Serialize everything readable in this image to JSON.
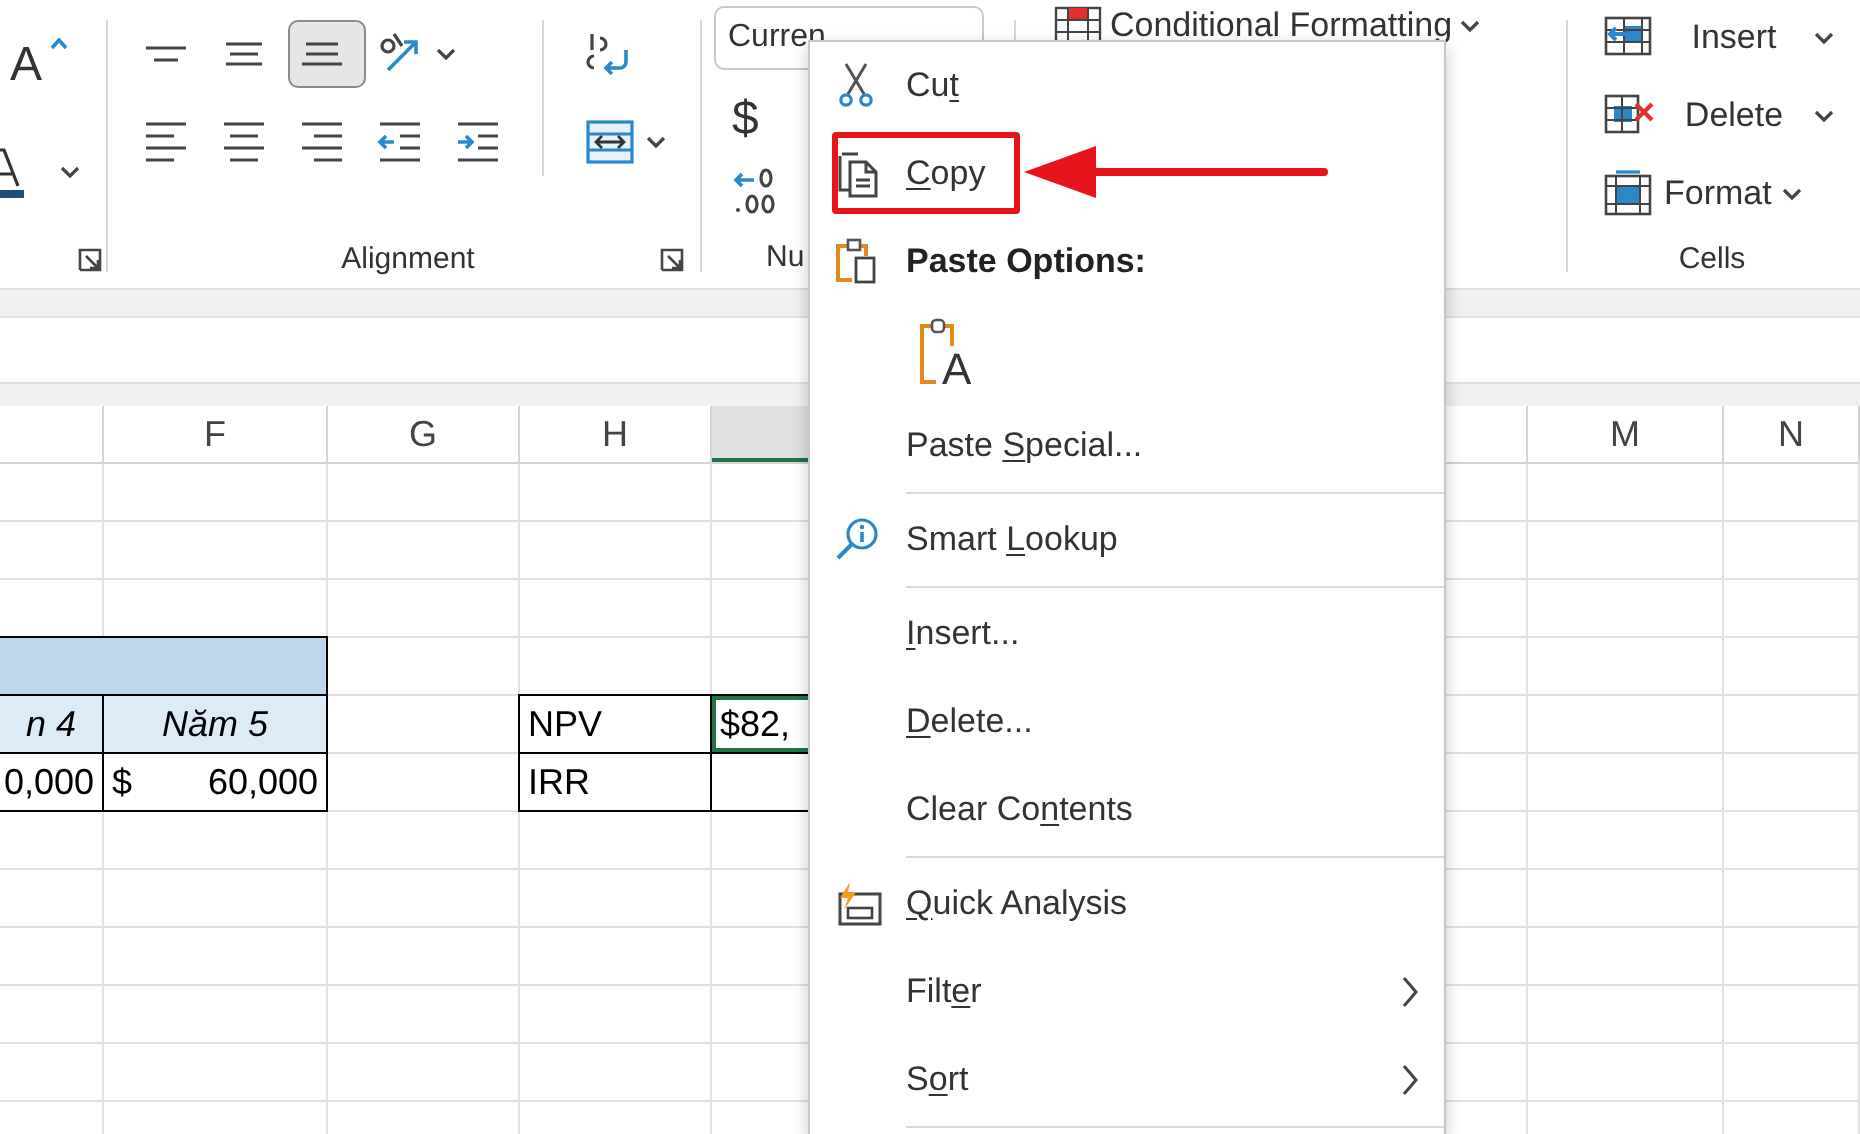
{
  "ribbon": {
    "font_group": {
      "grow_font_glyph": "A"
    },
    "alignment_group": {
      "label": "Alignment",
      "buttons": [
        {
          "kind": "align-top",
          "selected": false
        },
        {
          "kind": "align-middle",
          "selected": false
        },
        {
          "kind": "align-bottom",
          "selected": true
        },
        {
          "kind": "orientation",
          "selected": false,
          "has_menu": true
        },
        {
          "kind": "align-left",
          "selected": false
        },
        {
          "kind": "align-center",
          "selected": false
        },
        {
          "kind": "align-right",
          "selected": false
        },
        {
          "kind": "indent-decrease",
          "selected": false
        },
        {
          "kind": "indent-increase",
          "selected": false
        },
        {
          "kind": "wrap-text",
          "selected": false
        },
        {
          "kind": "merge",
          "selected": false,
          "has_menu": true
        }
      ]
    },
    "number_group": {
      "format_value": "Curren",
      "currency_glyph": "$",
      "label": "Nu"
    },
    "styles_group": {
      "conditional_formatting": "Conditional Formatting"
    },
    "cells_group": {
      "label": "Cells",
      "buttons": [
        {
          "kind": "insert",
          "label": "Insert"
        },
        {
          "kind": "delete",
          "label": "Delete"
        },
        {
          "kind": "format",
          "label": "Format"
        }
      ]
    }
  },
  "sheet": {
    "columns": [
      {
        "selected": false
      },
      {
        "label": "F",
        "selected": false
      },
      {
        "label": "G",
        "selected": false
      },
      {
        "label": "H",
        "selected": false
      },
      {
        "selected": true
      },
      {
        "selected": false
      },
      {
        "label": "M",
        "selected": false
      },
      {
        "label": "N",
        "selected": false
      }
    ],
    "data_rows": [
      {
        "cells": [
          {
            "kind": "band",
            "selected": false
          },
          {
            "kind": "band",
            "selected": false
          }
        ]
      },
      {
        "cells": [
          {
            "kind": "heading",
            "text": "n 4",
            "selected": false
          },
          {
            "kind": "heading",
            "text": "Năm 5",
            "selected": false
          },
          {},
          {
            "kind": "value",
            "text": "NPV",
            "selected": false
          },
          {
            "kind": "value",
            "text": "$82,",
            "selected": true
          }
        ]
      },
      {
        "cells": [
          {
            "kind": "amount",
            "text": "0,000",
            "selected": false
          },
          {
            "kind": "amount",
            "currency": "$",
            "text": "60,000",
            "selected": false
          },
          {},
          {
            "kind": "value",
            "text": "IRR",
            "selected": false
          },
          {
            "kind": "value",
            "selected": false
          }
        ]
      }
    ]
  },
  "context_menu": {
    "items": [
      {
        "kind": "cut",
        "before": "Cu",
        "key": "t",
        "highlighted": false
      },
      {
        "kind": "copy",
        "key": "C",
        "after": "opy",
        "highlighted": true
      },
      {
        "kind": "paste-heading",
        "before": "Paste Options:"
      },
      {
        "kind": "paste-options",
        "options": [
          {
            "glyph": "A"
          }
        ]
      },
      {
        "kind": "paste-special",
        "before": "Paste ",
        "key": "S",
        "after": "pecial...",
        "highlighted": false,
        "divider_after": true
      },
      {
        "kind": "smart-lookup",
        "before": "Smart ",
        "key": "L",
        "after": "ookup",
        "highlighted": false,
        "divider_after": true
      },
      {
        "kind": "insert",
        "key": "I",
        "after": "nsert...",
        "highlighted": false
      },
      {
        "kind": "delete",
        "key": "D",
        "after": "elete...",
        "highlighted": false
      },
      {
        "kind": "clear",
        "before": "Clear Co",
        "key": "n",
        "after": "tents",
        "highlighted": false,
        "divider_after": true
      },
      {
        "kind": "quick-analysis",
        "key": "Q",
        "after": "uick Analysis",
        "highlighted": false
      },
      {
        "kind": "filter",
        "before": "Filt",
        "key": "e",
        "after": "r",
        "highlighted": false,
        "submenu": true
      },
      {
        "kind": "sort",
        "before": "S",
        "key": "o",
        "after": "rt",
        "highlighted": false,
        "submenu": true,
        "divider_after": true
      }
    ]
  },
  "callout": {
    "kind": "arrow"
  }
}
